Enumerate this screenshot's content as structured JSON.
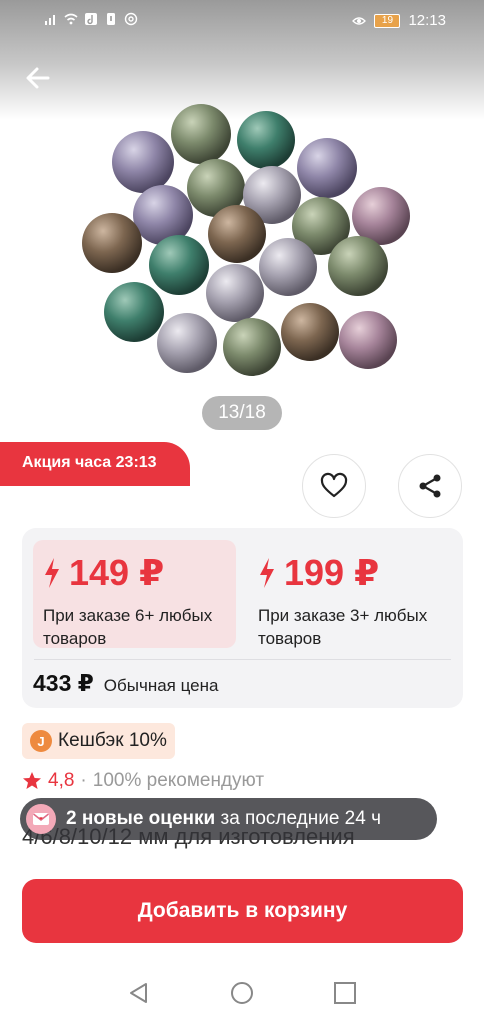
{
  "status_bar": {
    "time": "12:13",
    "battery_level": "19"
  },
  "gallery": {
    "counter": "13/18"
  },
  "promo": {
    "label": "Акция часа 23:13"
  },
  "prices": {
    "tiers": [
      {
        "price": "149 ₽",
        "condition": "При заказе 6+ любых товаров"
      },
      {
        "price": "199 ₽",
        "condition": "При заказе 3+ любых товаров"
      }
    ],
    "regular_price": "433 ₽",
    "regular_label": "Обычная цена"
  },
  "cashback": {
    "icon_letter": "J",
    "label": "Кешбэк 10%"
  },
  "rating": {
    "value": "4,8",
    "separator": "·",
    "recommend": "100% рекомендуют"
  },
  "product": {
    "title_partial": "4/6/8/10/12 мм для изготовления"
  },
  "toast": {
    "strong": "2 новые оценки",
    "rest": "за последние 24 ч"
  },
  "actions": {
    "add_to_cart": "Добавить в корзину"
  },
  "colors": {
    "accent": "#e8353f",
    "tier_bg": "#f7e1e3",
    "card_bg": "#f3f3f5",
    "cashback_bg": "#fde8dd"
  },
  "icons": [
    "back-arrow-icon",
    "heart-icon",
    "share-icon",
    "lightning-icon",
    "star-icon",
    "cashback-icon",
    "review-envelope-icon",
    "nav-back-icon",
    "nav-home-icon",
    "nav-recents-icon"
  ]
}
